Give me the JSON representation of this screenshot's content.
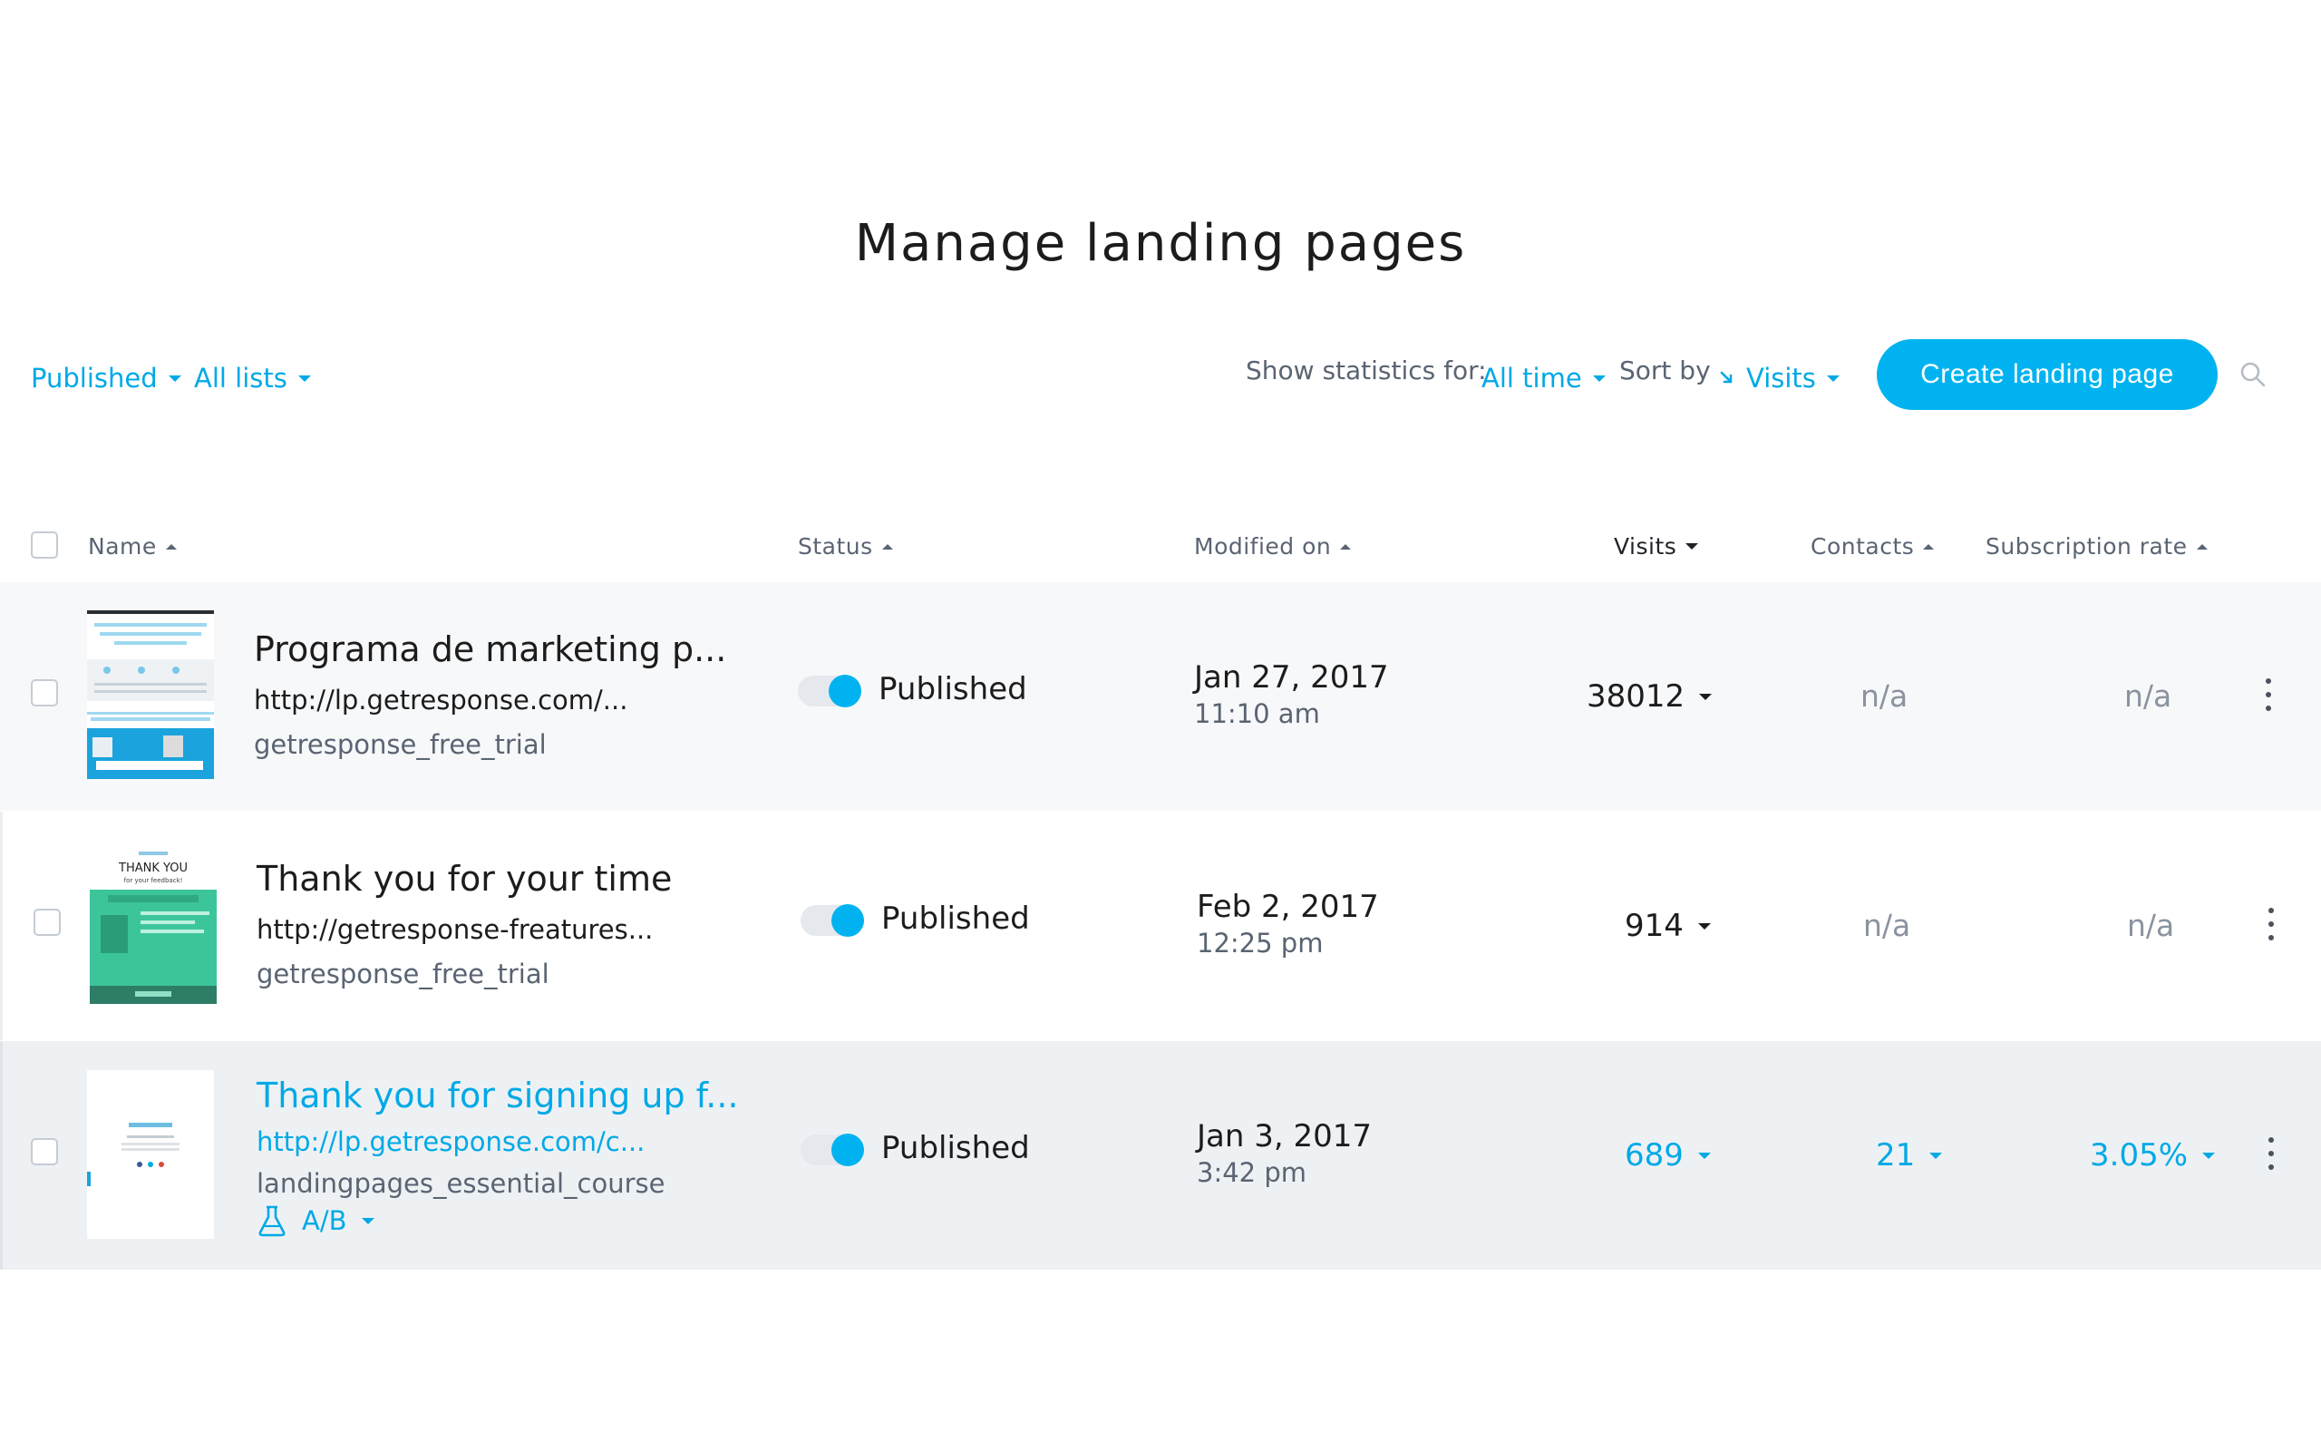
{
  "page": {
    "title": "Manage landing pages"
  },
  "filters": {
    "status_label": "Published",
    "lists_label": "All lists",
    "stats_label": "Show statistics for:",
    "stats_value": "All time",
    "sort_label": "Sort by",
    "sort_value": "Visits",
    "create_label": "Create landing page"
  },
  "columns": {
    "name": "Name",
    "status": "Status",
    "modified": "Modified on",
    "visits": "Visits",
    "contacts": "Contacts",
    "subscription": "Subscription rate"
  },
  "rows": [
    {
      "title": "Programa de marketing p...",
      "url": "http://lp.getresponse.com/...",
      "list": "getresponse_free_trial",
      "status": "Published",
      "date": "Jan 27, 2017",
      "time": "11:10 am",
      "visits": "38012",
      "contacts": "n/a",
      "subscription": "n/a"
    },
    {
      "title": "Thank you for your time",
      "url": "http://getresponse-freatures...",
      "list": "getresponse_free_trial",
      "status": "Published",
      "date": "Feb 2, 2017",
      "time": "12:25 pm",
      "visits": "914",
      "contacts": "n/a",
      "subscription": "n/a",
      "thumb_heading": "THANK YOU",
      "thumb_sub": "for your feedback!"
    },
    {
      "title": "Thank you for signing up f...",
      "url": "http://lp.getresponse.com/c...",
      "list": "landingpages_essential_course",
      "status": "Published",
      "date": "Jan 3, 2017",
      "time": "3:42 pm",
      "visits": "689",
      "contacts": "21",
      "subscription": "3.05%",
      "ab_label": "A/B"
    }
  ],
  "colors": {
    "accent": "#00b3f0",
    "link": "#00a9e6",
    "muted": "#5a6472"
  }
}
